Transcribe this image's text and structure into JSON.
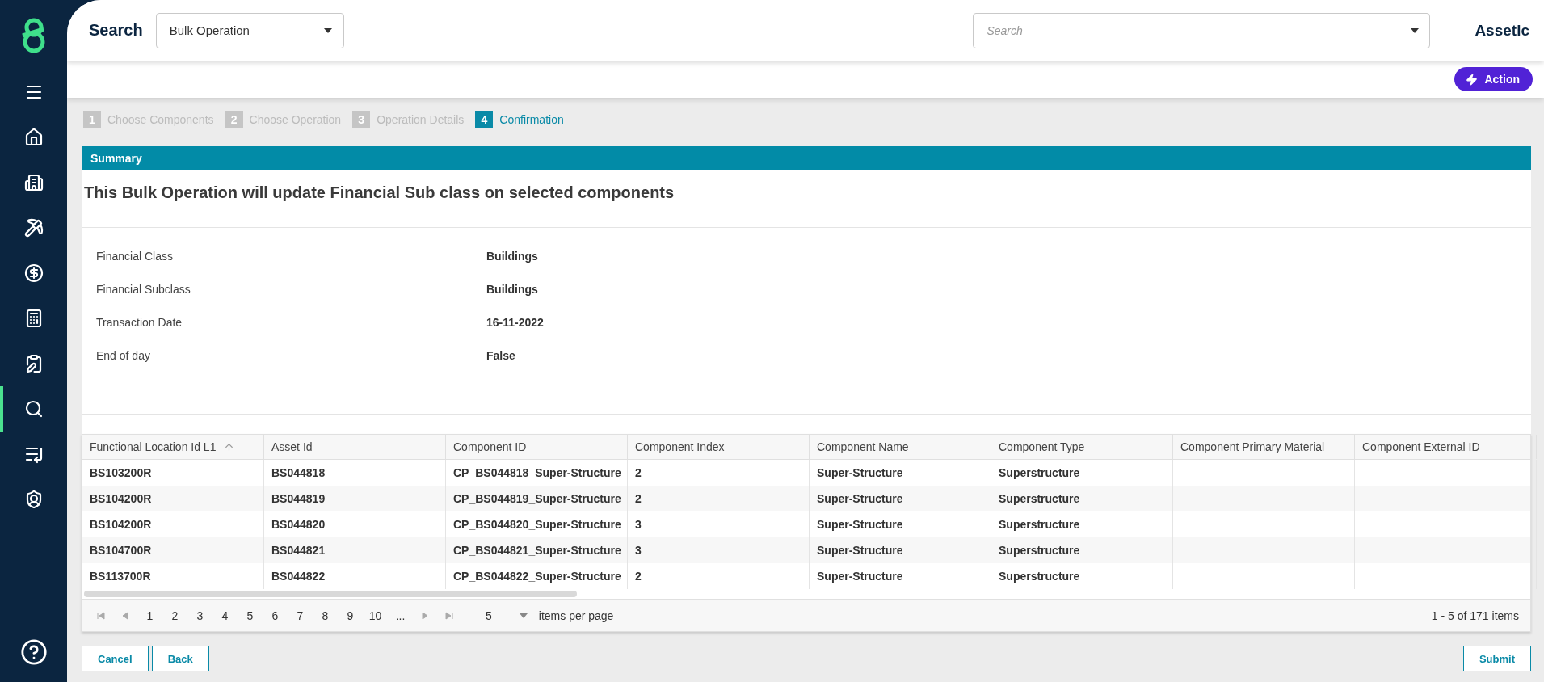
{
  "sidebar": {
    "items": [
      {
        "kind": "menu",
        "selected": false
      },
      {
        "kind": "home",
        "selected": false
      },
      {
        "kind": "building",
        "selected": false
      },
      {
        "kind": "worker",
        "selected": false
      },
      {
        "kind": "finance",
        "selected": false
      },
      {
        "kind": "calculator",
        "selected": false
      },
      {
        "kind": "edit",
        "selected": false
      },
      {
        "kind": "search",
        "selected": true
      },
      {
        "kind": "list",
        "selected": false
      },
      {
        "kind": "shield",
        "selected": false
      }
    ]
  },
  "header": {
    "title": "Search",
    "search_type": "Bulk Operation",
    "search": {
      "placeholder": "Search"
    },
    "brand": "Assetic"
  },
  "action_button": "Action",
  "steps": [
    {
      "number": "1",
      "label": "Choose Components",
      "selected": false
    },
    {
      "number": "2",
      "label": "Choose Operation",
      "selected": false
    },
    {
      "number": "3",
      "label": "Operation Details",
      "selected": false
    },
    {
      "number": "4",
      "label": "Confirmation",
      "selected": true
    }
  ],
  "summary": {
    "title": "Summary",
    "heading": "This Bulk Operation will update Financial Sub class on selected components",
    "fields": [
      {
        "label": "Financial Class",
        "value": "Buildings"
      },
      {
        "label": "Financial Subclass",
        "value": "Buildings"
      },
      {
        "label": "Transaction Date",
        "value": "16-11-2022"
      },
      {
        "label": "End of day",
        "value": "False"
      }
    ]
  },
  "table": {
    "columns": [
      {
        "label": "Functional Location Id L1",
        "sorted": true
      },
      {
        "label": "Asset Id",
        "sorted": false
      },
      {
        "label": "Component ID",
        "sorted": false
      },
      {
        "label": "Component Index",
        "sorted": false
      },
      {
        "label": "Component Name",
        "sorted": false
      },
      {
        "label": "Component Type",
        "sorted": false
      },
      {
        "label": "Component Primary Material",
        "sorted": false
      },
      {
        "label": "Component External ID",
        "sorted": false
      }
    ],
    "rows": [
      [
        "BS103200R",
        "BS044818",
        "CP_BS044818_Super-Structure",
        "2",
        "Super-Structure",
        "Superstructure",
        "",
        ""
      ],
      [
        "BS104200R",
        "BS044819",
        "CP_BS044819_Super-Structure",
        "2",
        "Super-Structure",
        "Superstructure",
        "",
        ""
      ],
      [
        "BS104200R",
        "BS044820",
        "CP_BS044820_Super-Structure",
        "3",
        "Super-Structure",
        "Superstructure",
        "",
        ""
      ],
      [
        "BS104700R",
        "BS044821",
        "CP_BS044821_Super-Structure",
        "3",
        "Super-Structure",
        "Superstructure",
        "",
        ""
      ],
      [
        "BS113700R",
        "BS044822",
        "CP_BS044822_Super-Structure",
        "2",
        "Super-Structure",
        "Superstructure",
        "",
        ""
      ]
    ]
  },
  "pager": {
    "pages": [
      "1",
      "2",
      "3",
      "4",
      "5",
      "6",
      "7",
      "8",
      "9",
      "10",
      "..."
    ],
    "page_size": "5",
    "page_size_label": "items per page",
    "info": "1 - 5 of 171 items"
  },
  "footer": {
    "cancel": "Cancel",
    "back": "Back",
    "submit": "Submit"
  }
}
